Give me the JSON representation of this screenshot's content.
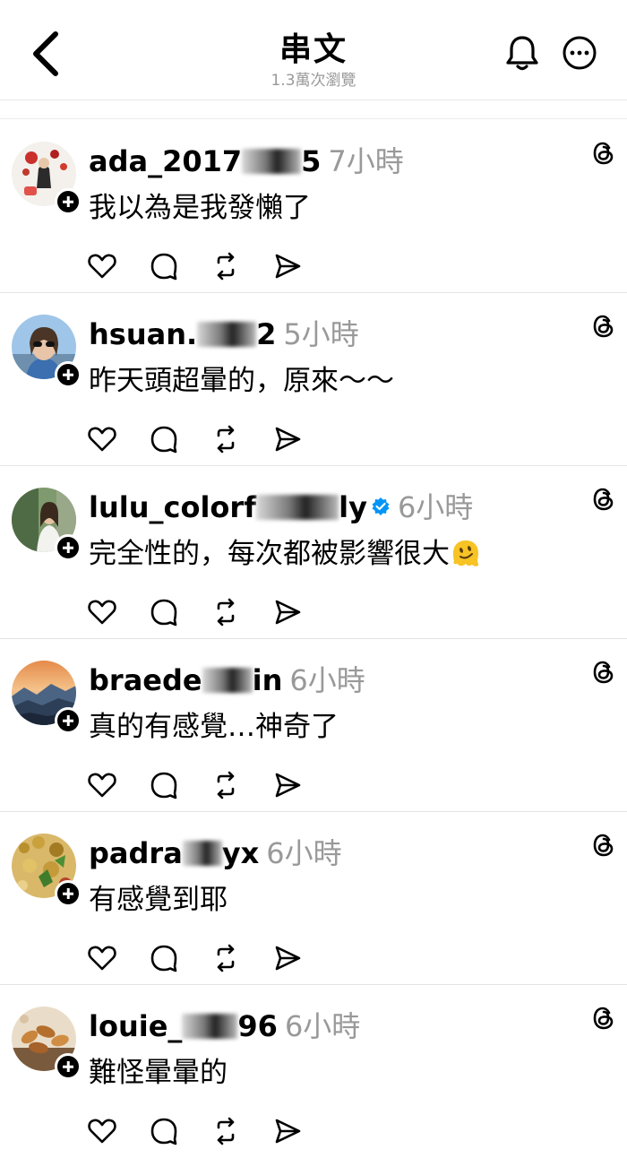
{
  "header": {
    "title": "串文",
    "subtitle": "1.3萬次瀏覽",
    "back_icon": "chevron-left-icon",
    "bell_icon": "bell-icon",
    "more_icon": "more-icon"
  },
  "posts": [
    {
      "username_a": "ada_2017",
      "username_b": "5",
      "time": "7小時",
      "text": "我以為是我發懶了",
      "verified": false
    },
    {
      "username_a": "hsuan.",
      "username_b": "2",
      "time": "5小時",
      "text": "昨天頭超暈的，原來～～",
      "verified": false
    },
    {
      "username_a": "lulu_colorf",
      "username_b": "ly",
      "time": "6小時",
      "text": "完全性的，每次都被影響很大",
      "verified": true,
      "emoji": "melting-face"
    },
    {
      "username_a": "braede",
      "username_b": "in",
      "time": "6小時",
      "text": "真的有感覺…神奇了",
      "verified": false
    },
    {
      "username_a": "padra",
      "username_b": "yx",
      "time": "6小時",
      "text": "有感覺到耶",
      "verified": false
    },
    {
      "username_a": "louie_",
      "username_b": "96",
      "time": "6小時",
      "text": "難怪暈暈的",
      "verified": false
    }
  ],
  "colors": {
    "muted": "#999999",
    "verified": "#0095f6",
    "divider": "#e4e4e4"
  }
}
